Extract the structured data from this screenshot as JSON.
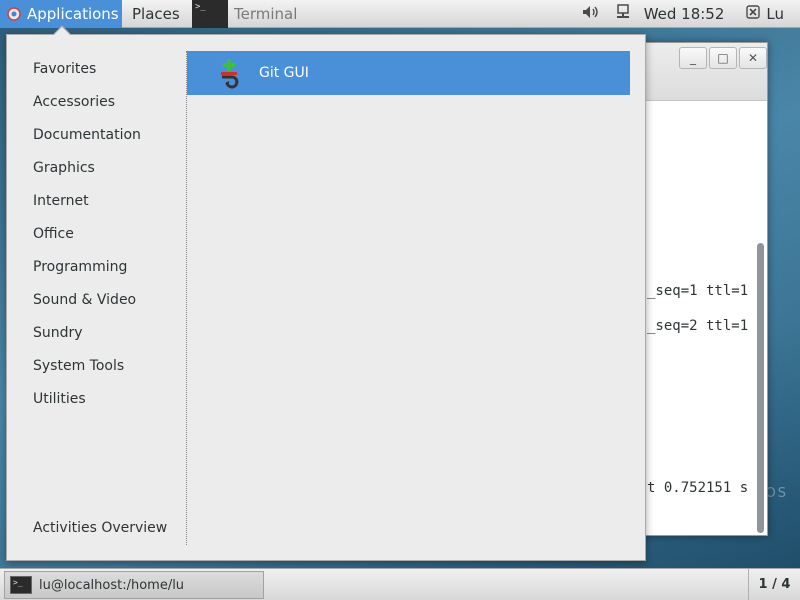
{
  "topbar": {
    "applications_label": "Applications",
    "places_label": "Places",
    "task_label": "Terminal",
    "task_thumb_text": ">_",
    "clock": "Wed 18:52",
    "user": "Lu",
    "accent_color": "#4a90d9"
  },
  "menu": {
    "categories": [
      "Favorites",
      "Accessories",
      "Documentation",
      "Graphics",
      "Internet",
      "Office",
      "Programming",
      "Sound & Video",
      "Sundry",
      "System Tools",
      "Utilities"
    ],
    "activities_label": "Activities Overview",
    "apps": [
      {
        "label": "Git GUI",
        "icon": "git-gui-icon",
        "selected": true
      }
    ]
  },
  "terminal": {
    "line1": "_seq=1 ttl=1",
    "line2": "_seq=2 ttl=1",
    "line3": "t 0.752151 s"
  },
  "bottombar": {
    "task_label": "lu@localhost:/home/lu",
    "workspace": "1 / 4"
  },
  "desktop": {
    "watermark": "OS"
  }
}
